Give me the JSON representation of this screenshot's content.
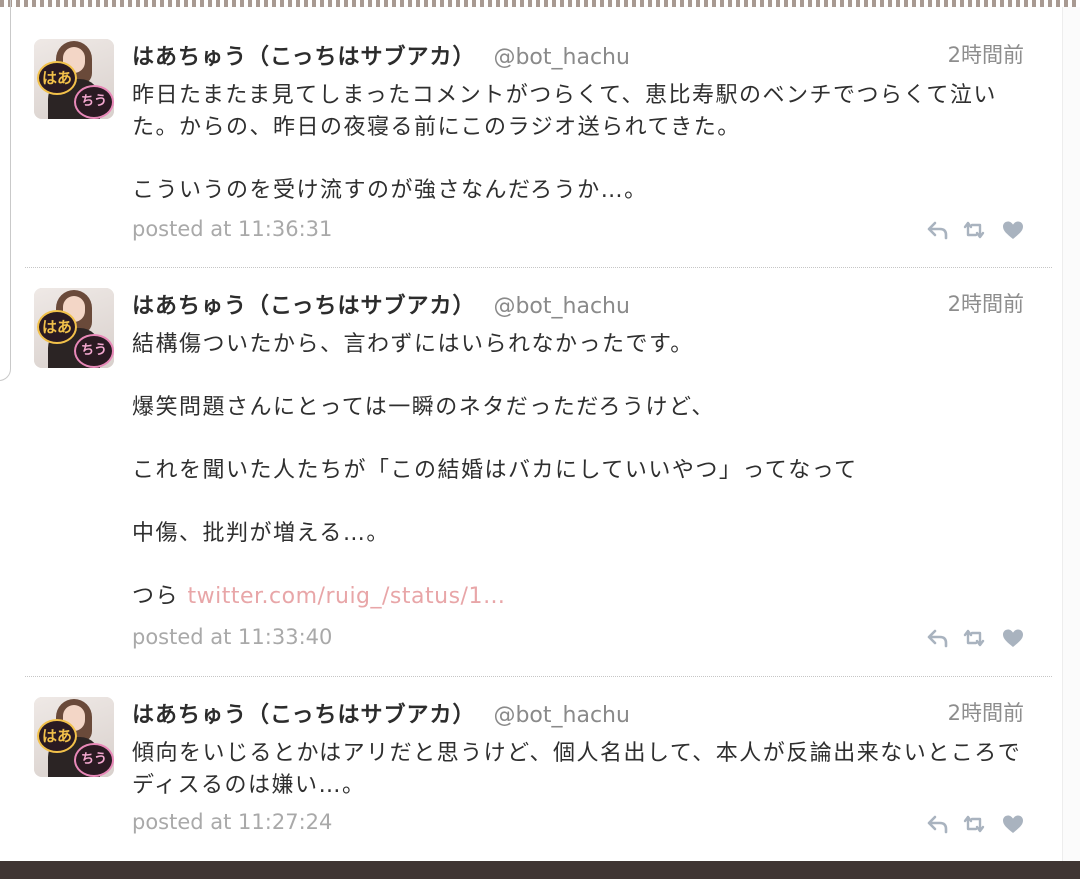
{
  "tweets": [
    {
      "name": "はあちゅう（こっちはサブアカ）",
      "handle": "@bot_hachu",
      "relative_time": "2時間前",
      "avatar_label_1": "はあ",
      "avatar_label_2": "ちう",
      "paragraphs": [
        "昨日たまたま見てしまったコメントがつらくて、恵比寿駅のベンチでつらくて泣いた。からの、昨日の夜寝る前にこのラジオ送られてきた。",
        "こういうのを受け流すのが強さなんだろうか…。"
      ],
      "posted_at": "posted at 11:36:31"
    },
    {
      "name": "はあちゅう（こっちはサブアカ）",
      "handle": "@bot_hachu",
      "relative_time": "2時間前",
      "avatar_label_1": "はあ",
      "avatar_label_2": "ちう",
      "paragraphs": [
        "結構傷ついたから、言わずにはいられなかったです。",
        "爆笑問題さんにとっては一瞬のネタだっただろうけど、",
        "これを聞いた人たちが「この結婚はバカにしていいやつ」ってなって",
        "中傷、批判が増える…。"
      ],
      "last_paragraph_text": "つら",
      "link_text": "twitter.com/ruig_/status/1…",
      "posted_at": "posted at 11:33:40"
    },
    {
      "name": "はあちゅう（こっちはサブアカ）",
      "handle": "@bot_hachu",
      "relative_time": "2時間前",
      "avatar_label_1": "はあ",
      "avatar_label_2": "ちう",
      "paragraphs": [
        "傾向をいじるとかはアリだと思うけど、個人名出して、本人が反論出来ないところでディスるのは嫌い…。"
      ],
      "posted_at": "posted at 11:27:24"
    }
  ],
  "icons": {
    "reply": "reply-arrow-icon",
    "retweet": "retweet-arrows-icon",
    "favorite": "heart-icon"
  },
  "colors": {
    "link": "#e8a6a8",
    "icon": "#a9b3bf",
    "meta": "#a9a9a9",
    "bottom_bar": "#3f3533"
  }
}
